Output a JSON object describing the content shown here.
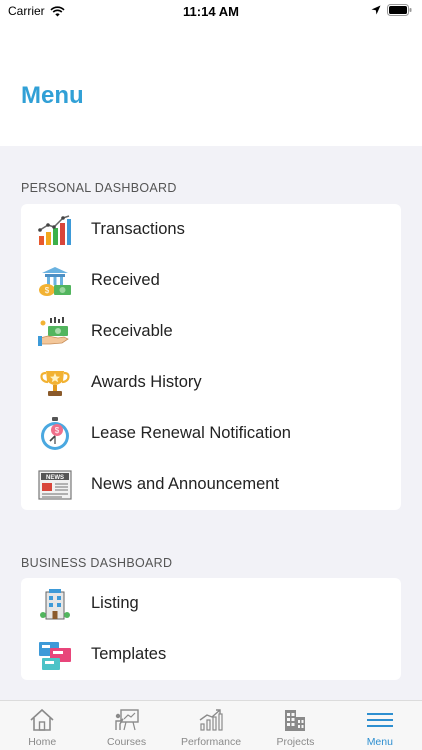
{
  "status_bar": {
    "carrier": "Carrier",
    "time": "11:14 AM"
  },
  "header": {
    "title": "Menu"
  },
  "sections": [
    {
      "title": "PERSONAL DASHBOARD",
      "items": [
        {
          "label": "Transactions",
          "icon": "bar-chart-icon"
        },
        {
          "label": "Received",
          "icon": "money-bank-icon"
        },
        {
          "label": "Receivable",
          "icon": "hand-cash-icon"
        },
        {
          "label": "Awards History",
          "icon": "trophy-icon"
        },
        {
          "label": "Lease Renewal Notification",
          "icon": "stopwatch-icon"
        },
        {
          "label": "News and Announcement",
          "icon": "news-icon"
        }
      ]
    },
    {
      "title": "BUSINESS DASHBOARD",
      "items": [
        {
          "label": "Listing",
          "icon": "building-icon"
        },
        {
          "label": "Templates",
          "icon": "templates-icon"
        }
      ]
    }
  ],
  "tab_bar": {
    "tabs": [
      {
        "label": "Home",
        "icon": "home-icon"
      },
      {
        "label": "Courses",
        "icon": "presentation-icon"
      },
      {
        "label": "Performance",
        "icon": "growth-chart-icon"
      },
      {
        "label": "Projects",
        "icon": "city-icon"
      },
      {
        "label": "Menu",
        "icon": "hamburger-icon",
        "active": true
      }
    ]
  },
  "colors": {
    "accent": "#31a0d6",
    "tab_active": "#2e8fd0",
    "background": "#f2f2f7"
  }
}
